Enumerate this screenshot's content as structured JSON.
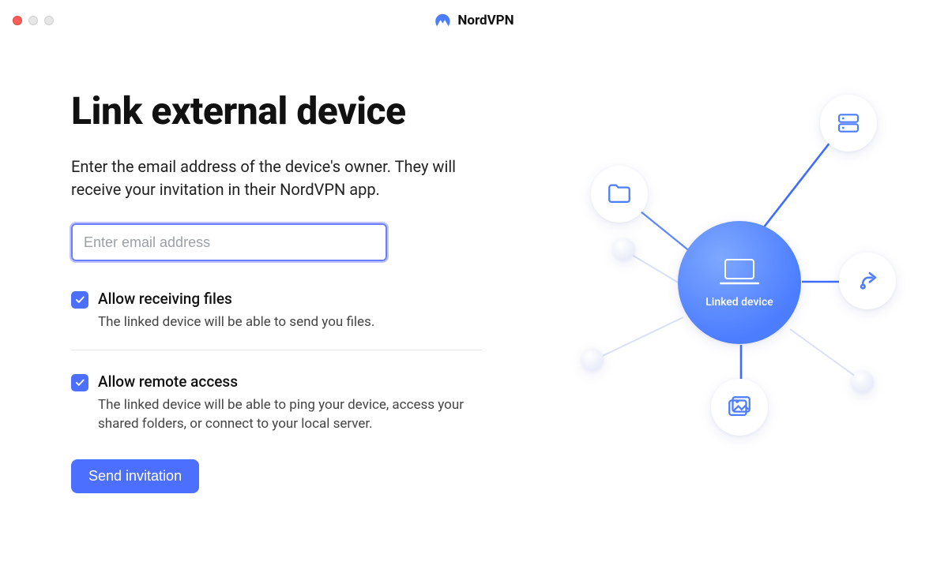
{
  "brand": {
    "name": "NordVPN"
  },
  "page": {
    "title": "Link external device",
    "subtitle": "Enter the email address of the device's owner. They will receive your invitation in their NordVPN app."
  },
  "email": {
    "value": "",
    "placeholder": "Enter email address"
  },
  "options": {
    "receive_files": {
      "checked": true,
      "label": "Allow receiving files",
      "desc": "The linked device will be able to send you files."
    },
    "remote_access": {
      "checked": true,
      "label": "Allow remote access",
      "desc": "The linked device will be able to ping your device, access your shared folders, or connect to your local server."
    }
  },
  "actions": {
    "send_label": "Send invitation"
  },
  "diagram": {
    "center_label": "Linked device",
    "icons": {
      "folder": "folder-icon",
      "server": "server-icon",
      "share": "share-icon",
      "image": "image-icon",
      "laptop": "laptop-icon"
    }
  },
  "colors": {
    "accent": "#4c6fff",
    "accent_light": "#7ea8ff"
  }
}
